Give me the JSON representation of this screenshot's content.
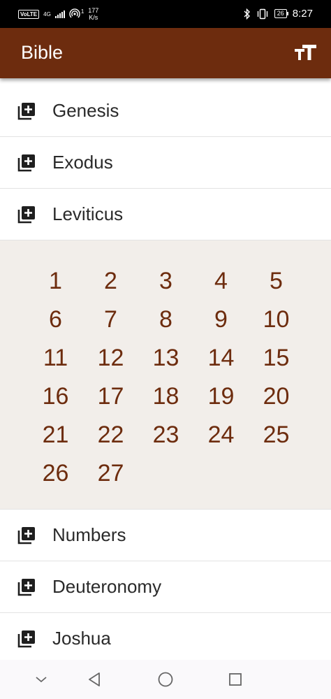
{
  "status_bar": {
    "volte": "VoLTE",
    "network": "4G",
    "data_speed_value": "177",
    "data_speed_unit": "K/s",
    "sim_index": "1",
    "battery": "26",
    "time": "8:27"
  },
  "app_bar": {
    "title": "Bible",
    "text_size_icon": "text-size-icon"
  },
  "books": [
    {
      "name": "Genesis",
      "icon": "add-box-icon"
    },
    {
      "name": "Exodus",
      "icon": "add-box-icon"
    },
    {
      "name": "Leviticus",
      "icon": "add-box-icon"
    }
  ],
  "chapters": [
    "1",
    "2",
    "3",
    "4",
    "5",
    "6",
    "7",
    "8",
    "9",
    "10",
    "11",
    "12",
    "13",
    "14",
    "15",
    "16",
    "17",
    "18",
    "19",
    "20",
    "21",
    "22",
    "23",
    "24",
    "25",
    "26",
    "27"
  ],
  "books_after": [
    {
      "name": "Numbers",
      "icon": "add-box-icon"
    },
    {
      "name": "Deuteronomy",
      "icon": "add-box-icon"
    },
    {
      "name": "Joshua",
      "icon": "add-box-icon"
    }
  ],
  "colors": {
    "app_bar": "#6d2c0e",
    "chapter_text": "#6d2c0e",
    "chapter_panel_bg": "#f2eeea"
  }
}
